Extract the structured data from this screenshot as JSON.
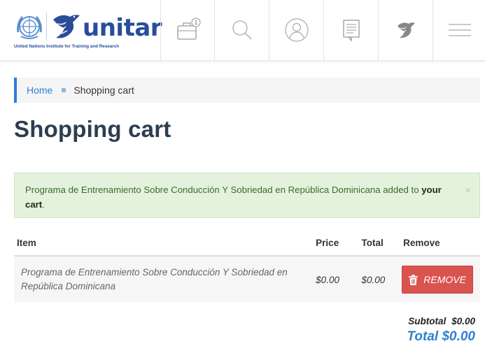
{
  "header": {
    "logo_wordmark": "unitar",
    "logo_tagline": "United Nations Institute for Training and Research",
    "cart_count": "1",
    "nav_icons": [
      "briefcase-icon",
      "search-icon",
      "user-icon",
      "message-icon",
      "bird-icon",
      "menu-icon"
    ]
  },
  "breadcrumb": {
    "home": "Home",
    "current": "Shopping cart"
  },
  "page_title": "Shopping cart",
  "alert": {
    "message": "Programa de Entrenamiento Sobre Conducción Y Sobriedad en República Dominicana added to ",
    "link": "your cart",
    "suffix": ".",
    "close": "×"
  },
  "table": {
    "headers": {
      "item": "Item",
      "price": "Price",
      "total": "Total",
      "remove": "Remove"
    },
    "rows": [
      {
        "item": "Programa de Entrenamiento Sobre Conducción Y Sobriedad en República Dominicana",
        "price": "$0.00",
        "total": "$0.00",
        "remove_label": "REMOVE"
      }
    ]
  },
  "summary": {
    "subtotal_label": "Subtotal",
    "subtotal_value": "$0.00",
    "total_label": "Total",
    "total_value": "$0.00"
  },
  "colors": {
    "accent": "#2f80d1",
    "brand": "#2a4d9b",
    "danger": "#d9534f",
    "success_bg": "#e4f2dd"
  }
}
